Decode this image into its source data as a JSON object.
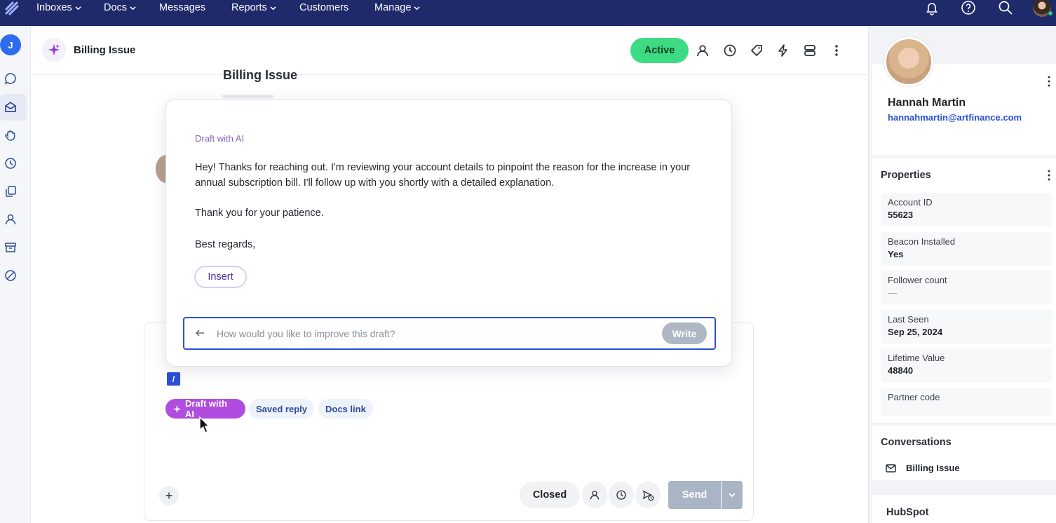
{
  "nav": {
    "items": [
      {
        "label": "Inboxes",
        "dropdown": true
      },
      {
        "label": "Docs",
        "dropdown": true
      },
      {
        "label": "Messages",
        "dropdown": false
      },
      {
        "label": "Reports",
        "dropdown": true
      },
      {
        "label": "Customers",
        "dropdown": false
      },
      {
        "label": "Manage",
        "dropdown": true
      }
    ],
    "icons": [
      "bell-icon",
      "help-icon",
      "search-icon",
      "user-avatar"
    ]
  },
  "rail": {
    "avatar_letter": "J",
    "icons": [
      "chat-icon",
      "inbox-icon",
      "hand-icon",
      "clock-icon",
      "docs-icon",
      "person-icon",
      "archive-icon",
      "spam-icon"
    ]
  },
  "header": {
    "title": "Billing Issue",
    "status": "Active"
  },
  "conversation": {
    "ghost_title": "Billing Issue"
  },
  "ai_draft": {
    "label": "Draft with AI",
    "body": "Hey! Thanks for reaching out. I'm reviewing your account details to pinpoint the reason for the increase in your annual subscription bill. I'll follow up with you shortly with a detailed explanation.",
    "thanks": "Thank you for your patience.",
    "signoff": "Best regards,",
    "insert_label": "Insert",
    "improve_placeholder": "How would you like to improve this draft?",
    "write_label": "Write"
  },
  "composer": {
    "slash": "/",
    "chips": [
      "Draft with AI",
      "Saved reply",
      "Docs link"
    ],
    "plus": "+",
    "closed_label": "Closed",
    "send_label": "Send"
  },
  "customer": {
    "name": "Hannah Martin",
    "email": "hannahmartin@artfinance.com"
  },
  "properties": {
    "title": "Properties",
    "items": [
      {
        "label": "Account ID",
        "value": "55623"
      },
      {
        "label": "Beacon Installed",
        "value": "Yes"
      },
      {
        "label": "Follower count",
        "value": "—"
      },
      {
        "label": "Last Seen",
        "value": "Sep 25, 2024"
      },
      {
        "label": "Lifetime Value",
        "value": "48840"
      },
      {
        "label": "Partner code",
        "value": ""
      }
    ]
  },
  "conversations": {
    "title": "Conversations",
    "item": "Billing Issue"
  },
  "hubspot": {
    "title": "HubSpot"
  },
  "colors": {
    "nav_bg": "#1f2a6b",
    "active_green": "#3ddc84",
    "ai_purple": "#b04de0",
    "link_blue": "#2b4fd6"
  }
}
